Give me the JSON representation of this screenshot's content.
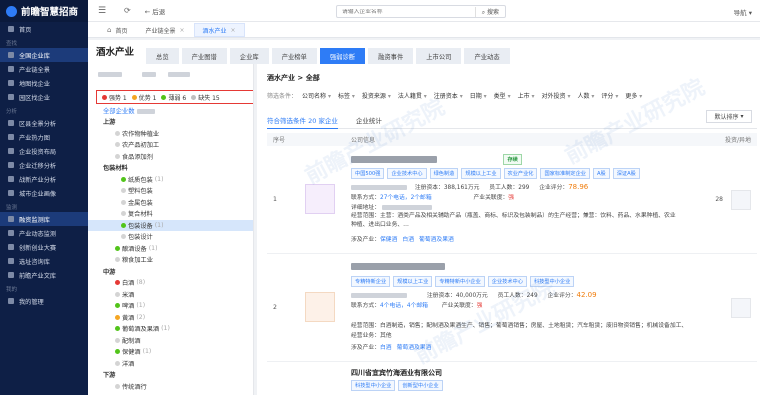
{
  "brand": {
    "name": "前瞻智慧招商"
  },
  "sidebar": {
    "items": [
      {
        "label": "首页",
        "active": false
      },
      {
        "group": "查找"
      },
      {
        "label": "全国企业库",
        "active": true
      },
      {
        "label": "产业链全景",
        "active": false
      },
      {
        "label": "地图找企业",
        "active": false
      },
      {
        "label": "园区找企业",
        "active": false
      },
      {
        "group": "分析"
      },
      {
        "label": "区县全景分析",
        "active": false
      },
      {
        "label": "产业热力图",
        "active": false
      },
      {
        "label": "企业投资布局",
        "active": false
      },
      {
        "label": "企业迁移分析",
        "active": false
      },
      {
        "label": "战新产业分析",
        "active": false
      },
      {
        "label": "城市企业画像",
        "active": false
      },
      {
        "group": "监测"
      },
      {
        "label": "融资监测库",
        "active": true
      },
      {
        "label": "产业动态监测",
        "active": false
      },
      {
        "label": "创新创业大赛",
        "active": false
      },
      {
        "label": "选址咨询库",
        "active": false
      },
      {
        "label": "前瞻产业文库",
        "active": false
      },
      {
        "group": "我的"
      },
      {
        "label": "我的管理",
        "active": false
      }
    ]
  },
  "topbar": {
    "back_label": "后退",
    "search_placeholder": "请输入企业名称",
    "search_button": "搜索",
    "nav_label": "导航"
  },
  "page_tabs": [
    {
      "label": "首页",
      "active": false
    },
    {
      "label": "产业链全景",
      "active": false
    },
    {
      "label": "酒水产业",
      "active": true
    }
  ],
  "main": {
    "title": "酒水产业",
    "tabs": [
      {
        "label": "总览",
        "active": false
      },
      {
        "label": "产业图谱",
        "active": false
      },
      {
        "label": "企业库",
        "active": false
      },
      {
        "label": "产业榜单",
        "active": false
      },
      {
        "label": "强弱诊断",
        "active": true
      },
      {
        "label": "融资事件",
        "active": false
      },
      {
        "label": "上市公司",
        "active": false
      },
      {
        "label": "产业动态",
        "active": false
      }
    ]
  },
  "legend": [
    {
      "label": "强势 1",
      "color": "#e53935"
    },
    {
      "label": "优势 1",
      "color": "#f5a623"
    },
    {
      "label": "薄弱 6",
      "color": "#52c41a"
    },
    {
      "label": "缺失 15",
      "color": "#bfbfbf"
    }
  ],
  "tree": {
    "all_label": "全部企业数",
    "nodes": [
      {
        "label": "上游",
        "level": 0,
        "bold": true
      },
      {
        "label": "农作物种植业",
        "level": 1
      },
      {
        "label": "农产品初加工",
        "level": 1
      },
      {
        "label": "食品添加剂",
        "level": 1
      },
      {
        "label": "包装材料",
        "level": 0,
        "bold": true
      },
      {
        "label": "纸质包装",
        "level": 2,
        "dot": "#52c41a",
        "count": "(1)"
      },
      {
        "label": "塑料包装",
        "level": 2
      },
      {
        "label": "金属包装",
        "level": 2
      },
      {
        "label": "复合材料",
        "level": 2
      },
      {
        "label": "包装设备",
        "level": 2,
        "dot": "#52c41a",
        "count": "(1)",
        "selected": true
      },
      {
        "label": "包装设计",
        "level": 2
      },
      {
        "label": "酿酒设备",
        "level": 1,
        "dot": "#52c41a",
        "count": "(1)"
      },
      {
        "label": "粮食加工业",
        "level": 1
      },
      {
        "label": "中游",
        "level": 0,
        "bold": true
      },
      {
        "label": "白酒",
        "level": 1,
        "dot": "#e53935",
        "count": "(8)"
      },
      {
        "label": "米酒",
        "level": 1
      },
      {
        "label": "啤酒",
        "level": 1,
        "dot": "#52c41a",
        "count": "(1)"
      },
      {
        "label": "黄酒",
        "level": 1,
        "dot": "#f5a623",
        "count": "(2)"
      },
      {
        "label": "葡萄酒及果酒",
        "level": 1,
        "dot": "#52c41a",
        "count": "(1)"
      },
      {
        "label": "配制酒",
        "level": 1
      },
      {
        "label": "保健酒",
        "level": 1,
        "dot": "#52c41a",
        "count": "(1)"
      },
      {
        "label": "洋酒",
        "level": 1
      },
      {
        "label": "下游",
        "level": 0,
        "bold": true
      },
      {
        "label": "传统酒行",
        "level": 1
      }
    ]
  },
  "content": {
    "breadcrumb": "酒水产业 > 全部",
    "filter_label": "筛选条件：",
    "filters": [
      "公司名称",
      "标签",
      "投资来源",
      "法人籍贯",
      "注册资本",
      "日期",
      "类型",
      "上市",
      "对外投资",
      "人数",
      "评分",
      "更多"
    ],
    "result_tab": "符合筛选条件 20 家企业",
    "stats_tab": "企业统计",
    "sort_label": "默认排序",
    "columns": {
      "index": "序号",
      "company": "公司信息",
      "score": "投资/异地"
    },
    "rows": [
      {
        "index": "1",
        "badge": "存续",
        "tags": [
          "中国500强",
          "企业技术中心",
          "绿色制造",
          "规模以上工业",
          "农业产业化",
          "国家标准制定企业",
          "A股",
          "深证A股"
        ],
        "reg_capital_label": "注册资本：",
        "reg_capital": "388,161万元",
        "staff_label": "员工人数：",
        "staff": "299",
        "rating_label": "企业评分：",
        "rating": "78.96",
        "contact_label": "联系方式：",
        "contact": "27个电话，2个邮箱",
        "assoc_label": "产业关联度：",
        "assoc": "强",
        "address_label": "详细地址：",
        "scope": "经营范围：主营：酒类产品及相关辅助产品（瓶盖、商标、标识及包装制品）的生产经营；兼营：饮料、药品、水果种植、农业种植、进出口业务、…",
        "industry_label": "涉及产业：",
        "industries": [
          "保健酒",
          "白酒",
          "葡萄酒及果酒"
        ],
        "score_value": "28"
      },
      {
        "index": "2",
        "tags": [
          "专精特新企业",
          "规模以上工业",
          "专精特新中小企业",
          "企业技术中心",
          "科技型中小企业"
        ],
        "reg_capital_label": "注册资本：",
        "reg_capital": "40,000万元",
        "staff_label": "员工人数：",
        "staff": "249",
        "rating_label": "企业评分：",
        "rating": "42.09",
        "contact_label": "联系方式：",
        "contact": "4个电话，4个邮箱",
        "assoc_label": "产业关联度：",
        "assoc": "强",
        "scope": "经营范围：白酒制造，销售；配制酒及果酒生产、销售；葡萄酒销售；房屋、土地租赁；汽车租赁；废旧物资销售；机械设备加工、",
        "extra_label": "经营业务：其他",
        "industry_label": "涉及产业：",
        "industries": [
          "白酒",
          "葡萄酒及果酒"
        ]
      },
      {
        "index": "3",
        "name": "四川省宜宾竹海酒业有限公司",
        "tags": [
          "科技型中小企业",
          "创新型中小企业"
        ]
      }
    ]
  },
  "watermark": "前瞻产业研究院"
}
